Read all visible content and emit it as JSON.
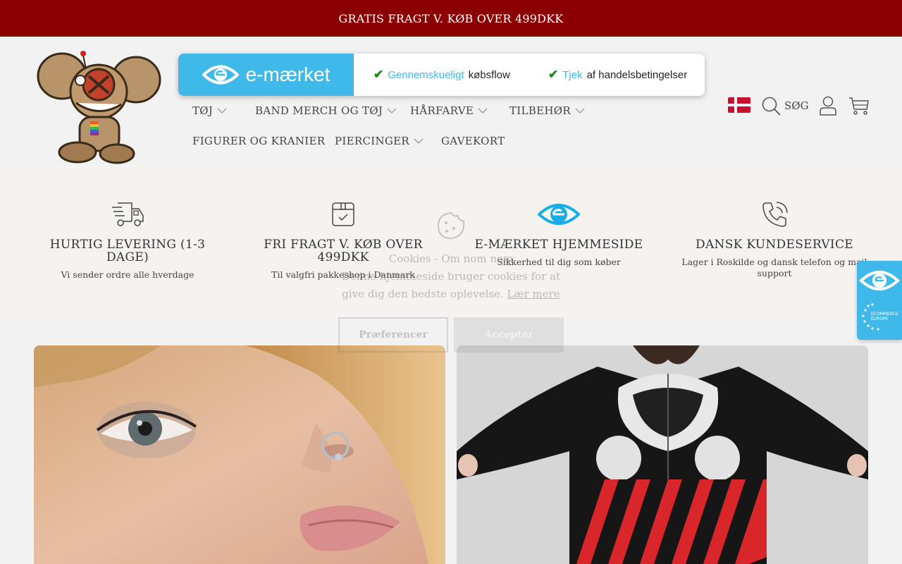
{
  "topbar": {
    "text": "GRATIS FRAGT V. KØB OVER 499DKK"
  },
  "emarket": {
    "brand": "e-mærket",
    "item1": {
      "highlight": "Gennemskueligt",
      "rest": "købsflow"
    },
    "item2": {
      "highlight": "Tjek",
      "rest": "af handelsbetingelser"
    }
  },
  "nav": {
    "items": [
      {
        "label": "TØJ",
        "dropdown": true
      },
      {
        "label": "BAND MERCH OG TØJ",
        "dropdown": true
      },
      {
        "label": "HÅRFARVE",
        "dropdown": true
      },
      {
        "label": "TILBEHØR",
        "dropdown": true
      },
      {
        "label": "FIGURER OG KRANIER",
        "dropdown": false
      },
      {
        "label": "PIERCINGER",
        "dropdown": true
      },
      {
        "label": "GAVEKORT",
        "dropdown": false
      }
    ]
  },
  "tools": {
    "search_label": "SØG"
  },
  "usps": [
    {
      "icon": "delivery-truck-icon",
      "title": "HURTIG LEVERING (1-3 DAGE)",
      "sub": "Vi sender ordre alle hverdage"
    },
    {
      "icon": "package-check-icon",
      "title": "FRI FRAGT V. KØB OVER 499DKK",
      "sub": "Til valgfri pakkeshop i Danmark"
    },
    {
      "icon": "emaerket-icon",
      "title": "E-MÆRKET HJEMMESIDE",
      "sub": "Sikkerhed til dig som køber"
    },
    {
      "icon": "phone-icon",
      "title": "DANSK KUNDESERVICE",
      "sub": "Lager i Roskilde og dansk telefon og mail support"
    }
  ],
  "cookie": {
    "title": "Cookies - Om nom nom",
    "text": "Denne hjemmeside bruger cookies for at give dig den bedste oplevelse.",
    "link": "Lær mere",
    "preferences": "Præferencer",
    "accept": "Accepter"
  },
  "trust_badge": {
    "label1": "ECOMMERCE",
    "label2": "EUROPE"
  },
  "colors": {
    "topbar": "#8b0000",
    "emarket_blue": "#3fb9ea",
    "check_green": "#1a8a1a"
  }
}
